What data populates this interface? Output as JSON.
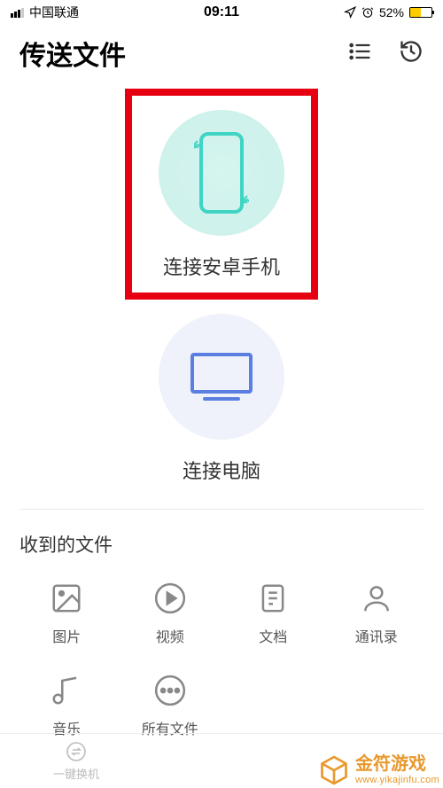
{
  "status": {
    "carrier": "中国联通",
    "time": "09:11",
    "battery_pct": "52%",
    "battery_fill_width": "52%"
  },
  "header": {
    "title": "传送文件"
  },
  "options": {
    "android": {
      "label": "连接安卓手机"
    },
    "pc": {
      "label": "连接电脑"
    }
  },
  "received": {
    "title": "收到的文件",
    "items": [
      {
        "label": "图片"
      },
      {
        "label": "视频"
      },
      {
        "label": "文档"
      },
      {
        "label": "通讯录"
      },
      {
        "label": "音乐"
      },
      {
        "label": "所有文件"
      }
    ]
  },
  "bottom": {
    "switch_phone": "一键换机"
  },
  "watermark": {
    "cn": "金符游戏",
    "en": "www.yikajinfu.com"
  },
  "colors": {
    "highlight_border": "#e60012",
    "accent_teal": "#3fd4c3",
    "accent_blue": "#5a7fe0",
    "battery_yellow": "#ffcc00",
    "watermark_orange": "#e8992e"
  }
}
